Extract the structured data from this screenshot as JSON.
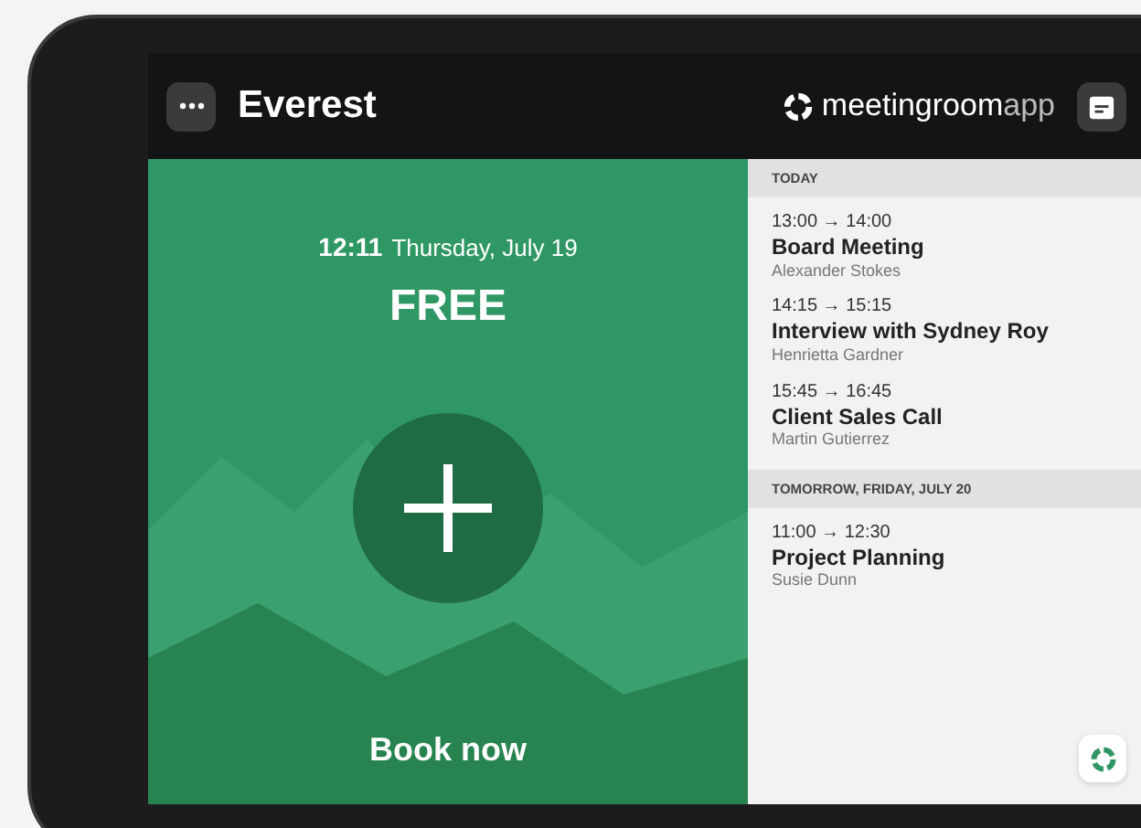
{
  "header": {
    "room": "Everest",
    "brand_main": "meetingroom",
    "brand_suffix": "app"
  },
  "status_panel": {
    "time": "12:11",
    "date": "Thursday, July 19",
    "status": "FREE",
    "action": "Book now"
  },
  "schedule": [
    {
      "heading": "TODAY",
      "events": [
        {
          "time": "13:00 → 14:00",
          "title": "Board Meeting",
          "organizer": "Alexander Stokes"
        },
        {
          "time": "14:15 → 15:15",
          "title": "Interview with Sydney Roy",
          "organizer": "Henrietta Gardner"
        },
        {
          "time": "15:45 → 16:45",
          "title": "Client Sales Call",
          "organizer": "Martin Gutierrez"
        }
      ]
    },
    {
      "heading": "TOMORROW, FRIDAY, JULY 20",
      "events": [
        {
          "time": "11:00 → 12:30",
          "title": "Project Planning",
          "organizer": "Susie Dunn"
        }
      ]
    }
  ]
}
